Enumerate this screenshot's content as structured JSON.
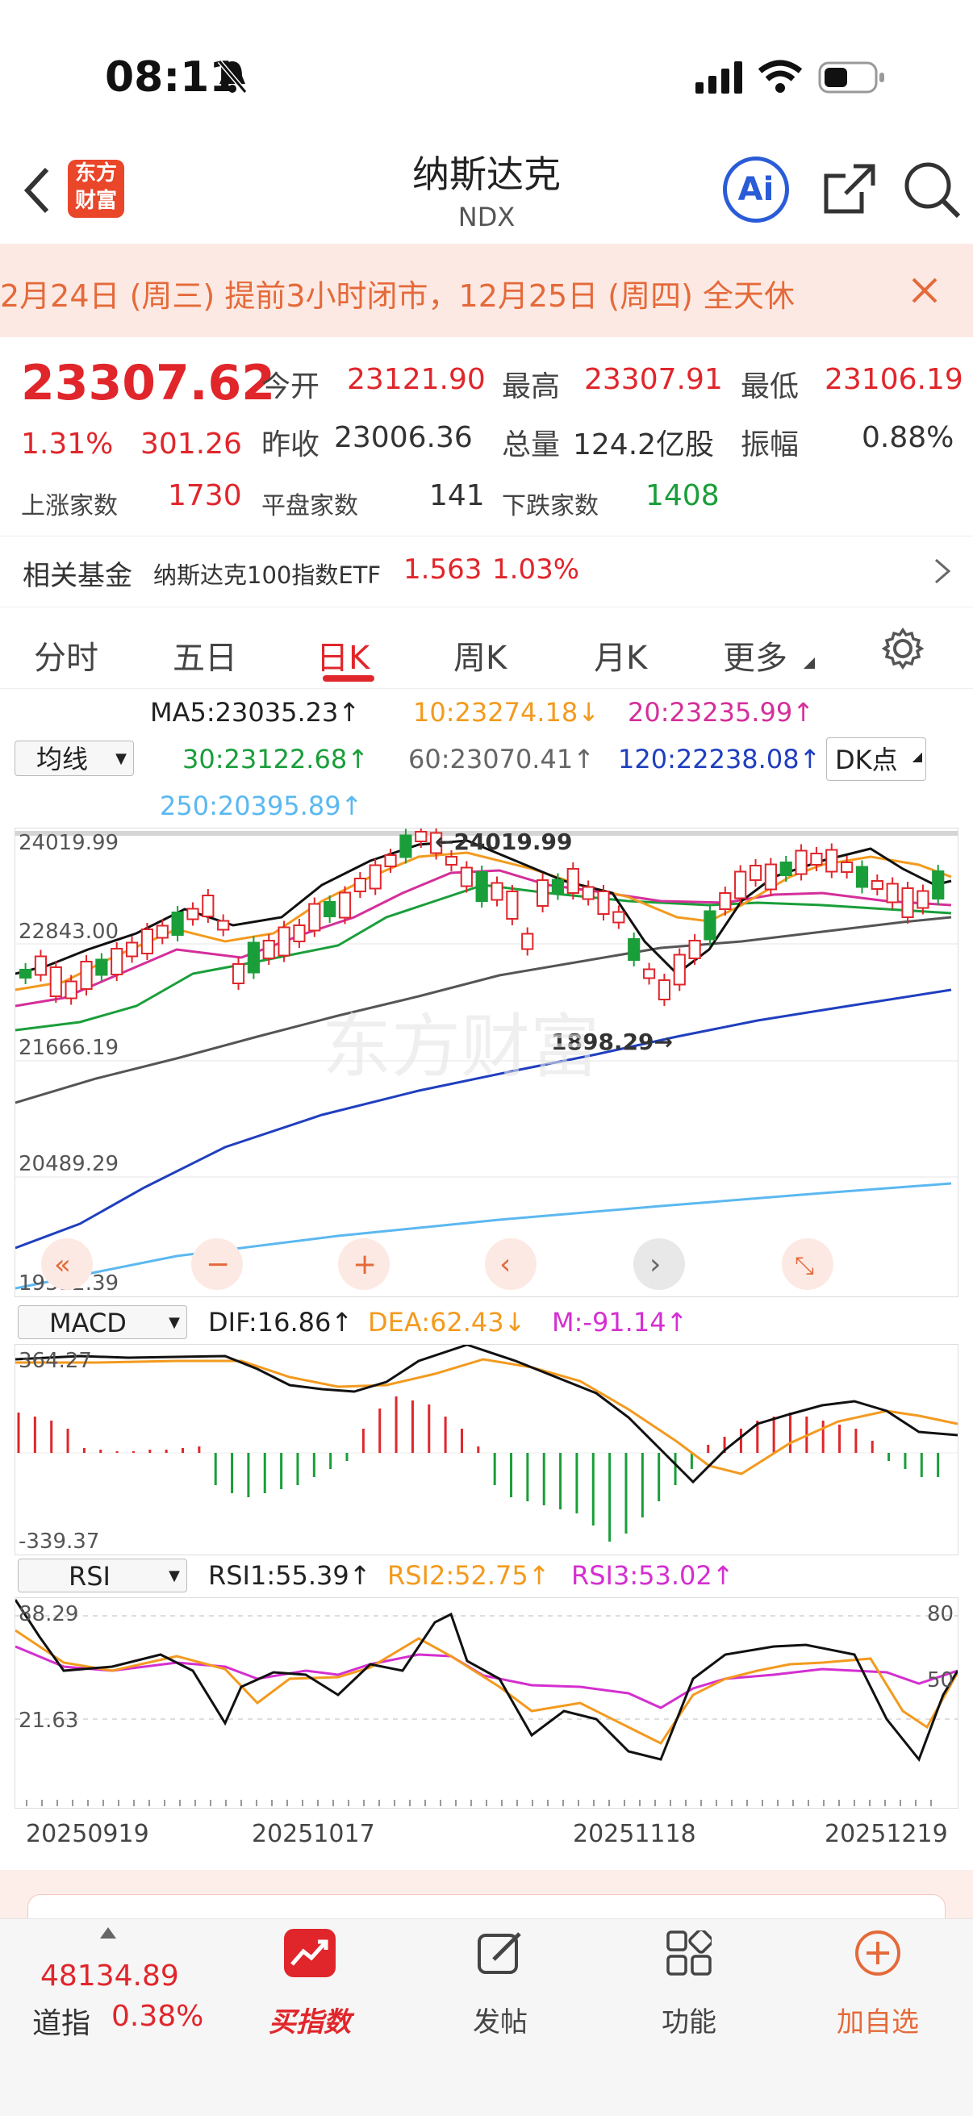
{
  "status": {
    "time": "08:11"
  },
  "header": {
    "title": "纳斯达克",
    "subtitle": "NDX",
    "logo_text": "东方财富",
    "ai_label": "Ai"
  },
  "banner": {
    "text": "2月24日 (周三) 提前3小时闭市，12月25日 (周四) 全天休"
  },
  "quote": {
    "price": "23307.62",
    "pct": "1.31%",
    "change": "301.26",
    "open_label": "今开",
    "open": "23121.90",
    "high_label": "最高",
    "high": "23307.91",
    "low_label": "最低",
    "low": "23106.19",
    "prev_label": "昨收",
    "prev": "23006.36",
    "vol_label": "总量",
    "vol": "124.2亿股",
    "amp_label": "振幅",
    "amp": "0.88%",
    "up_label": "上涨家数",
    "up": "1730",
    "flat_label": "平盘家数",
    "flat": "141",
    "down_label": "下跌家数",
    "down": "1408"
  },
  "fund": {
    "label": "相关基金",
    "name": "纳斯达克100指数ETF",
    "price": "1.563",
    "pct": "1.03%"
  },
  "tabs": [
    "分时",
    "五日",
    "日K",
    "周K",
    "月K",
    "更多"
  ],
  "ma": {
    "selector": "均线",
    "ma5": "MA5:23035.23↑",
    "ma10": "10:23274.18↓",
    "ma20": "20:23235.99↑",
    "ma30": "30:23122.68↑",
    "ma60": "60:23070.41↑",
    "ma120": "120:22238.08↑",
    "ma250": "250:20395.89↑",
    "dk": "DK点"
  },
  "kline": {
    "y_labels": [
      "24019.99",
      "22843.00",
      "21666.19",
      "20489.29",
      "19312.39"
    ],
    "max_label": "←24019.99",
    "min_label": "1898.29→",
    "watermark": "东方财富"
  },
  "macd": {
    "selector": "MACD",
    "dif": "DIF:16.86↑",
    "dea": "DEA:62.43↓",
    "m": "M:-91.14↑",
    "top": "364.27",
    "bottom": "-339.37"
  },
  "rsi": {
    "selector": "RSI",
    "rsi1": "RSI1:55.39↑",
    "rsi2": "RSI2:52.75↑",
    "rsi3": "RSI3:53.02↑",
    "top": "88.29",
    "bottom": "21.63",
    "r80": "80",
    "r50": "50"
  },
  "dates": [
    "20250919",
    "20251017",
    "20251118",
    "20251219"
  ],
  "bottom": {
    "dji_value": "48134.89",
    "dji_label": "道指",
    "dji_pct": "0.38%",
    "nav": [
      "买指数",
      "发帖",
      "功能",
      "加自选"
    ]
  },
  "colors": {
    "red": "#e0262b",
    "green": "#1a9e3a",
    "orange": "#f39a1e",
    "magenta": "#d42fd0",
    "blue": "#1f3fbf",
    "lightblue": "#5bb8f0"
  }
}
